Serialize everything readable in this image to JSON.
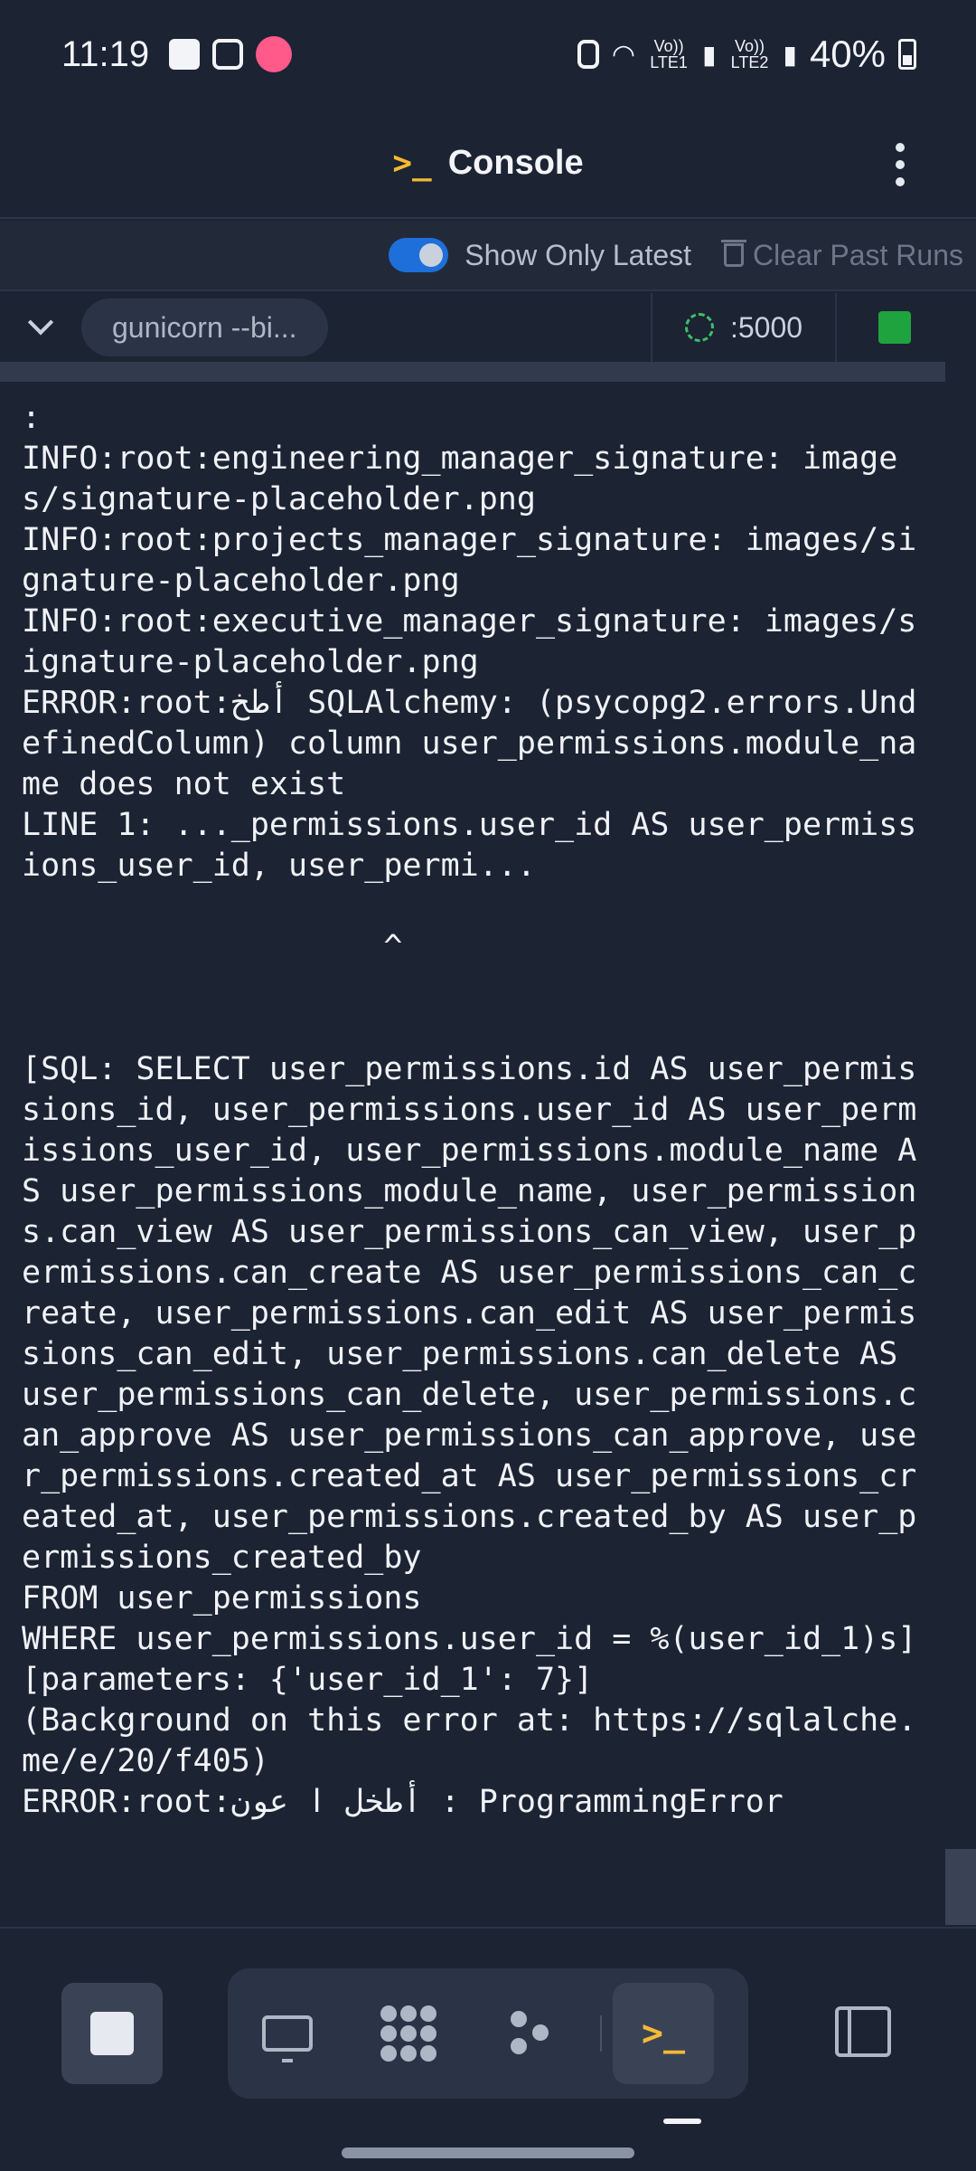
{
  "status_bar": {
    "time": "11:19",
    "net1": "Vo)) LTE1",
    "net2": "Vo)) LTE2",
    "battery": "40%"
  },
  "header": {
    "prompt_icon": ">_",
    "title": "Console"
  },
  "toolbar": {
    "show_only_latest_label": "Show Only Latest",
    "show_only_latest_on": true,
    "clear_label": "Clear Past Runs"
  },
  "process": {
    "command": "gunicorn --bi...",
    "port": ":5000",
    "status_color": "#1fa33f"
  },
  "console": {
    "lines": [
      ":",
      "INFO:root:engineering_manager_signature: images/signature-placeholder.png",
      "INFO:root:projects_manager_signature: images/signature-placeholder.png",
      "INFO:root:executive_manager_signature: images/signature-placeholder.png",
      "ERROR:root:أطخ SQLAlchemy: (psycopg2.errors.UndefinedColumn) column user_permissions.module_name does not exist",
      "LINE 1: ..._permissions.user_id AS user_permissions_user_id, user_permi...",
      "",
      "                   ^",
      "",
      "",
      "[SQL: SELECT user_permissions.id AS user_permissions_id, user_permissions.user_id AS user_permissions_user_id, user_permissions.module_name AS user_permissions_module_name, user_permissions.can_view AS user_permissions_can_view, user_permissions.can_create AS user_permissions_can_create, user_permissions.can_edit AS user_permissions_can_edit, user_permissions.can_delete AS user_permissions_can_delete, user_permissions.can_approve AS user_permissions_can_approve, user_permissions.created_at AS user_permissions_created_at, user_permissions.created_by AS user_permissions_created_by",
      "FROM user_permissions",
      "WHERE user_permissions.user_id = %(user_id_1)s]",
      "[parameters: {'user_id_1': 7}]",
      "(Background on this error at: https://sqlalche.me/e/20/f405)",
      "ERROR:root:أطخل ا عون : ProgrammingError"
    ]
  },
  "bottom_bar": {
    "terminal_icon": ">_"
  },
  "colors": {
    "background": "#1c2333",
    "accent": "#1e6fd9",
    "prompt": "#f5b935",
    "running": "#1fa33f"
  }
}
